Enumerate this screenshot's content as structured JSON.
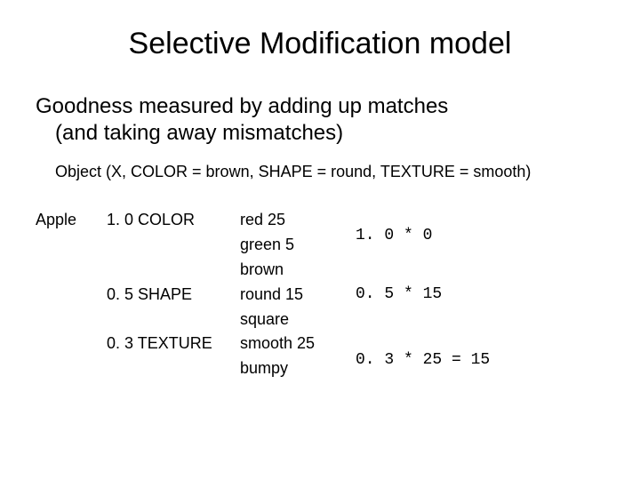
{
  "title": "Selective Modification model",
  "subtitle_line1": "Goodness measured by adding up matches",
  "subtitle_line2": "(and taking away mismatches)",
  "object_line": "Object (X, COLOR = brown, SHAPE = round, TEXTURE = smooth)",
  "concept": "Apple",
  "attrs": {
    "color_weight": "1. 0 COLOR",
    "shape_weight": "0. 5 SHAPE",
    "texture_weight": "0. 3 TEXTURE"
  },
  "values": {
    "red": "red 25",
    "green": "green 5",
    "brown": "brown",
    "round": "round 15",
    "square": "square",
    "smooth": "smooth 25",
    "bumpy": "bumpy"
  },
  "calcs": {
    "c1": "1. 0 * 0",
    "c2": "0. 5 * 15",
    "c3": "0. 3 * 25 = 15"
  }
}
